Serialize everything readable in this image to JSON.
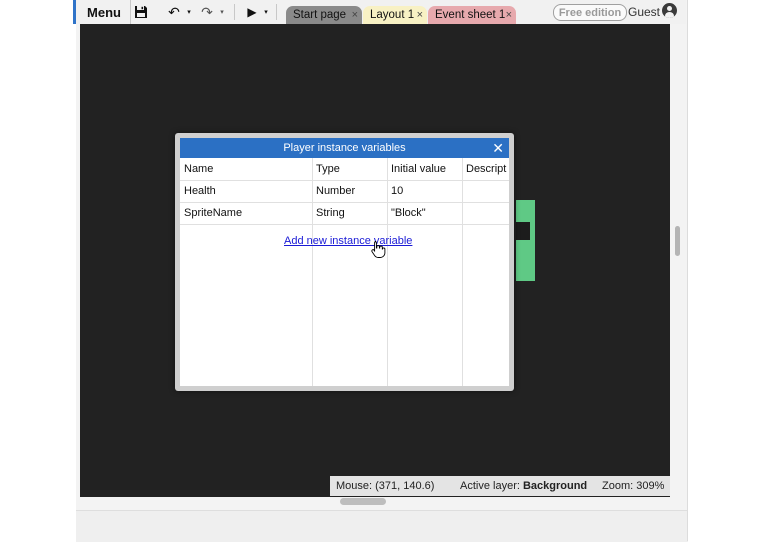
{
  "toolbar": {
    "menu_label": "Menu",
    "save_icon": "save-icon",
    "undo_icon": "undo-icon",
    "redo_icon": "redo-icon",
    "play_icon": "play-icon",
    "undo_glyph": "↶",
    "redo_glyph": "↷",
    "play_glyph": "▶",
    "dropdown_glyph": "▾"
  },
  "tabs": [
    {
      "label": "Start page",
      "close": "×",
      "color": "#8a8a8a"
    },
    {
      "label": "Layout 1",
      "close": "×",
      "color": "#f8f1c4"
    },
    {
      "label": "Event sheet 1",
      "close": "×",
      "color": "#e7a9ad"
    }
  ],
  "account": {
    "edition_label": "Free edition",
    "user_label": "Guest"
  },
  "dialog": {
    "title": "Player instance variables",
    "close_glyph": "✕",
    "columns": [
      "Name",
      "Type",
      "Initial value",
      "Descript"
    ],
    "rows": [
      {
        "name": "Health",
        "type": "Number",
        "value": "10"
      },
      {
        "name": "SpriteName",
        "type": "String",
        "value": "\"Block\""
      }
    ],
    "add_link": "Add new instance variable"
  },
  "status": {
    "mouse": "Mouse: (371, 140.6)",
    "layer_label": "Active layer: ",
    "layer_value": "Background",
    "zoom": "Zoom: 309%"
  },
  "colors": {
    "accent": "#2b70c4",
    "canvas": "#222222",
    "sprite": "#5fc985"
  }
}
